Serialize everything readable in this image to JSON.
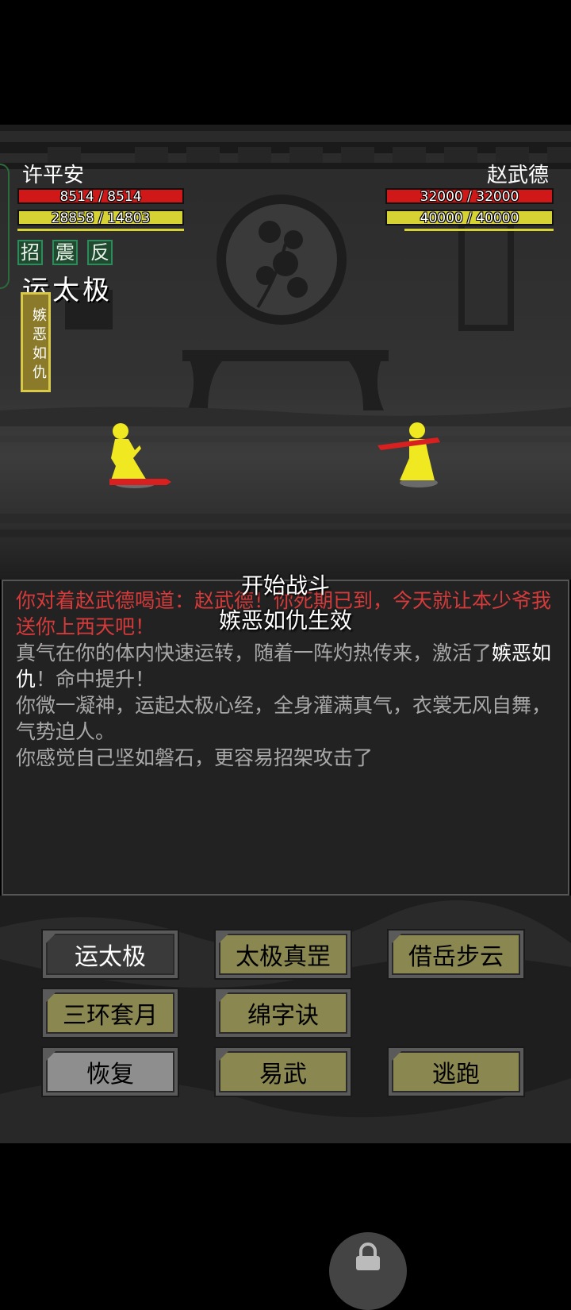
{
  "player": {
    "name": "许平安",
    "hp_text": "8514 / 8514",
    "hp_fraction": 1.0,
    "mp_text": "28858 / 14803",
    "mp_fraction": 1.0,
    "status_tags": [
      "招",
      "震",
      "反"
    ],
    "active_skill": "运太极",
    "buff": "嫉恶如仇"
  },
  "enemy": {
    "name": "赵武德",
    "hp_text": "32000 / 32000",
    "hp_fraction": 1.0,
    "mp_text": "40000 / 40000",
    "mp_fraction": 1.0
  },
  "floating_text": {
    "line1": "开始战斗",
    "line2": "嫉恶如仇生效"
  },
  "log": [
    {
      "color": "red",
      "text": "你对着赵武德喝道：赵武德！你死期已到，今天就让本少爷我送你上西天吧！"
    },
    {
      "color": "grey",
      "parts": [
        "真气在你的体内快速运转，随着一阵灼热传来，激活了",
        "嫉恶如仇",
        "！命中提升！"
      ]
    },
    {
      "color": "grey",
      "text": "你微一凝神，运起太极心经，全身灌满真气，衣裳无风自舞，气势迫人。"
    },
    {
      "color": "grey",
      "text": "你感觉自己坚如磐石，更容易招架攻击了"
    }
  ],
  "actions": {
    "row1": [
      "运太极",
      "太极真罡",
      "借岳步云"
    ],
    "row2": [
      "三环套月",
      "绵字诀"
    ],
    "row3": [
      "恢复",
      "易武",
      "逃跑"
    ]
  },
  "colors": {
    "hp": "#d01818",
    "mp": "#d6d234",
    "figure": "#f0e820",
    "weapon": "#d82020"
  },
  "icons": [
    "lock-icon"
  ]
}
